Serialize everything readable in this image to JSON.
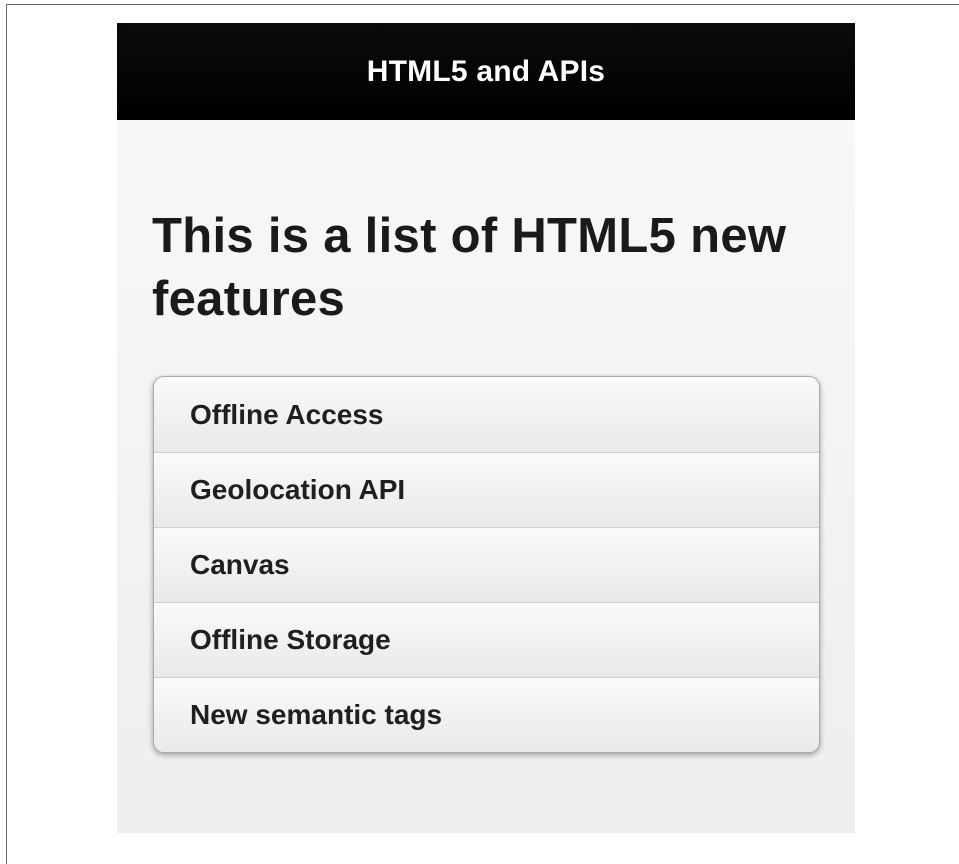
{
  "header": {
    "title": "HTML5 and APIs"
  },
  "main": {
    "heading": "This is a list of HTML5 new features",
    "list": [
      {
        "label": "Offline Access"
      },
      {
        "label": "Geolocation API"
      },
      {
        "label": "Canvas"
      },
      {
        "label": "Offline Storage"
      },
      {
        "label": "New semantic tags"
      }
    ]
  },
  "colors": {
    "header_bg": "#000000",
    "header_text": "#ffffff",
    "page_bg": "#f2f2f2"
  }
}
